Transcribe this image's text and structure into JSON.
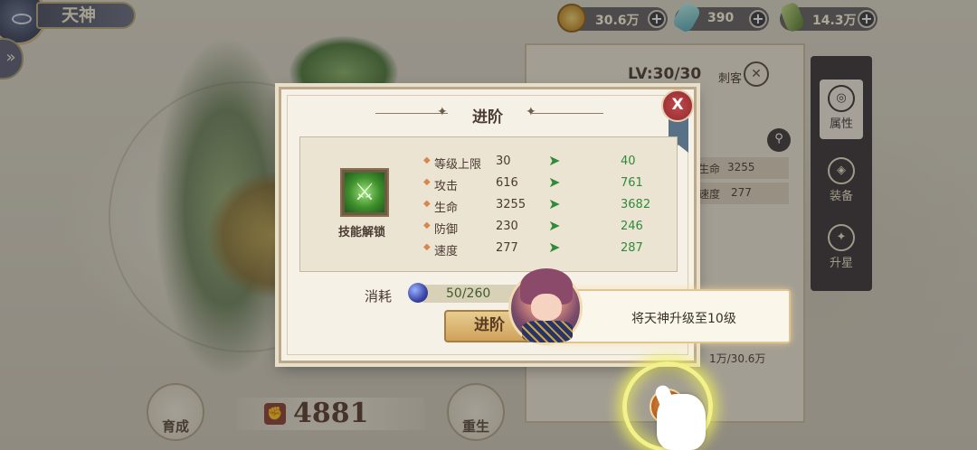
{
  "header": {
    "hero_name": "天神",
    "currencies": [
      {
        "icon": "gold-coin-icon",
        "value": "30.6万",
        "color": "#d8a640"
      },
      {
        "icon": "crystal-icon",
        "value": "390",
        "color": "#6fc8c8"
      },
      {
        "icon": "potion-icon",
        "value": "14.3万",
        "color": "#6fa03e"
      }
    ],
    "plus_symbol": "+"
  },
  "hero_panel": {
    "level": "LV:30/30",
    "class": "刺客",
    "stats_partial": [
      {
        "name_fragment": "生命",
        "value": "3255"
      },
      {
        "name_fragment": "速度",
        "value": "277"
      }
    ],
    "gold_cost_fragment": "1万/30.6万"
  },
  "side_tabs": [
    {
      "label": "属性",
      "active": true
    },
    {
      "label": "装备",
      "active": false
    },
    {
      "label": "升星",
      "active": false
    }
  ],
  "bottom": {
    "develop_label": "育成",
    "power_value": "4881",
    "rebirth_label": "重生"
  },
  "dialog": {
    "title": "进阶",
    "close_symbol": "X",
    "skill_unlock_label": "技能解锁",
    "stats": [
      {
        "name": "等级上限",
        "current": "30",
        "next": "40"
      },
      {
        "name": "攻击",
        "current": "616",
        "next": "761"
      },
      {
        "name": "生命",
        "current": "3255",
        "next": "3682"
      },
      {
        "name": "防御",
        "current": "230",
        "next": "246"
      },
      {
        "name": "速度",
        "current": "277",
        "next": "287"
      }
    ],
    "cost_label": "消耗",
    "cost_value": "50/260",
    "advance_button": "进阶"
  },
  "tutorial": {
    "message": "将天神升级至10级"
  },
  "colors": {
    "accent_green": "#2f8a3a",
    "highlight_ring": "#f3f18a",
    "close_red": "#b23a3e"
  }
}
